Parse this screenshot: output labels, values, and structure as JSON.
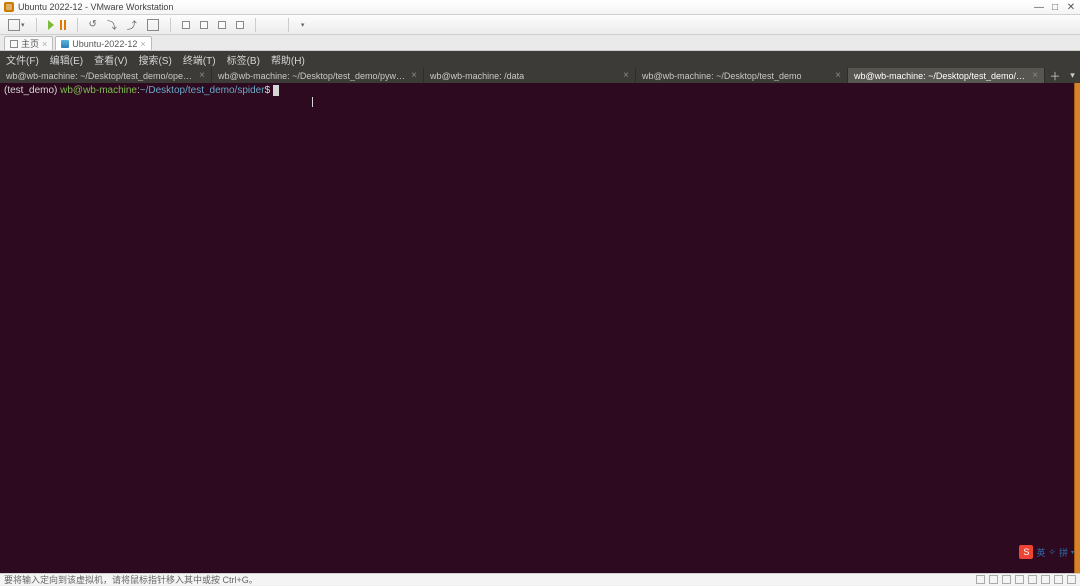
{
  "window": {
    "title": "Ubuntu 2022-12 - VMware Workstation",
    "controls": {
      "min": "—",
      "max": "□",
      "close": "✕"
    }
  },
  "toolbar": {
    "dropdown_caret": "▾"
  },
  "subtabs": {
    "home": {
      "label": "主页"
    },
    "vm": {
      "label": "Ubuntu-2022-12"
    },
    "close_glyph": "×"
  },
  "ubuntu_menu": {
    "items": [
      "文件(F)",
      "编辑(E)",
      "查看(V)",
      "搜索(S)",
      "终端(T)",
      "标签(B)",
      "帮助(H)"
    ]
  },
  "terminal_tabs": {
    "tabs": [
      {
        "label": "wb@wb-machine: ~/Desktop/test_demo/openc…"
      },
      {
        "label": "wb@wb-machine: ~/Desktop/test_demo/pywo…"
      },
      {
        "label": "wb@wb-machine: /data"
      },
      {
        "label": "wb@wb-machine: ~/Desktop/test_demo"
      },
      {
        "label": "wb@wb-machine: ~/Desktop/test_demo/spider"
      }
    ],
    "close_glyph": "×",
    "add_glyph": "＋",
    "more_glyph": "▾"
  },
  "prompt": {
    "venv": "(test_demo)",
    "userhost": "wb@wb-machine",
    "colon": ":",
    "path": "~/Desktop/test_demo/spider",
    "dollar": "$"
  },
  "status": {
    "text": "要将输入定向到该虚拟机，请将鼠标指针移入其中或按 Ctrl+G。"
  },
  "ime": {
    "s": "S",
    "mode1": "英",
    "sep": "✧",
    "mode2": "拼",
    "caret": "▾"
  }
}
